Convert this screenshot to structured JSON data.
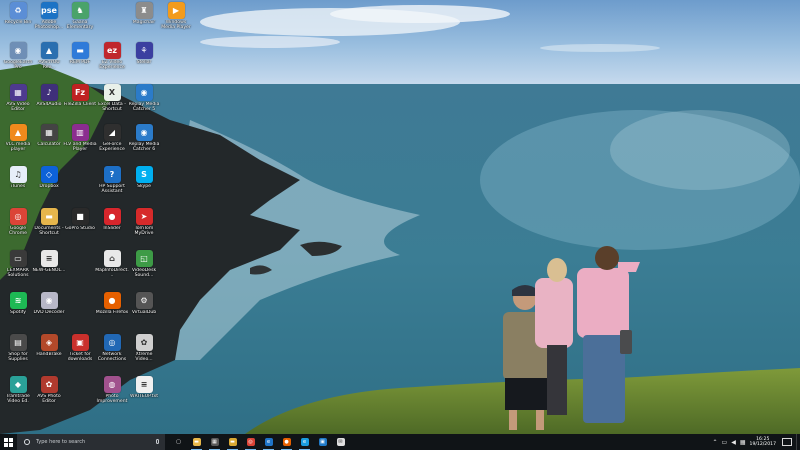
{
  "desktop": {
    "icons": [
      {
        "label": "Recycle Bin",
        "icon": "recycle-bin-icon",
        "color": "#5b8ed6",
        "glyph": "♻"
      },
      {
        "label": "GoogleEarth Pro",
        "icon": "google-earth-icon",
        "color": "#6f8fb6",
        "glyph": "◉"
      },
      {
        "label": "AVS Video Editor",
        "icon": "avs-video-editor-icon",
        "color": "#4e3a8f",
        "glyph": "▦"
      },
      {
        "label": "VLC media player",
        "icon": "vlc-icon",
        "color": "#f08a1c",
        "glyph": "▲"
      },
      {
        "label": "iTunes",
        "icon": "itunes-icon",
        "color": "#e7eef9",
        "glyph": "♫"
      },
      {
        "label": "Google Chrome",
        "icon": "chrome-icon",
        "color": "#db4437",
        "glyph": "◎"
      },
      {
        "label": "LEXMARK Solutions",
        "icon": "lexmark-icon",
        "color": "#3a3a3a",
        "glyph": "▭"
      },
      {
        "label": "Spotify",
        "icon": "spotify-icon",
        "color": "#1db954",
        "glyph": "≋"
      },
      {
        "label": "Shop for Supplies",
        "icon": "shop-supplies-icon",
        "color": "#4a4a4a",
        "glyph": "▤"
      },
      {
        "label": "Tramtrade Video Ed.",
        "icon": "tramtrade-video-icon",
        "color": "#2aa198",
        "glyph": "◆"
      },
      {
        "label": "Adobe Photoshop...",
        "icon": "photoshop-elements-icon",
        "color": "#1c73c5",
        "glyph": "pse"
      },
      {
        "label": "AVS4YOU Rev...",
        "icon": "avs4you-icon",
        "color": "#2a6fb0",
        "glyph": "▲"
      },
      {
        "label": "AVS4Audio",
        "icon": "avs-audio-icon",
        "color": "#3f2f7a",
        "glyph": "♪"
      },
      {
        "label": "Calculator",
        "icon": "calculator-icon",
        "color": "#444444",
        "glyph": "▦"
      },
      {
        "label": "Dropbox",
        "icon": "dropbox-icon",
        "color": "#0d62d8",
        "glyph": "◇"
      },
      {
        "label": "Documents - Shortcut",
        "icon": "documents-folder-icon",
        "color": "#e6b64c",
        "glyph": "▬"
      },
      {
        "label": "NEW-GENOL...",
        "icon": "new-document-icon",
        "color": "#e8e8e8",
        "glyph": "≡"
      },
      {
        "label": "DVD Decoder",
        "icon": "dvd-decoder-icon",
        "color": "#b7b7c7",
        "glyph": "◉"
      },
      {
        "label": "HandBrake",
        "icon": "handbrake-icon",
        "color": "#b2492a",
        "glyph": "◈"
      },
      {
        "label": "AVS Photo Editor",
        "icon": "avs-photo-editor-icon",
        "color": "#b03a2e",
        "glyph": "✿"
      },
      {
        "label": "Gaana Elementary",
        "icon": "gaana-elementary-icon",
        "color": "#4aa36a",
        "glyph": "♞"
      },
      {
        "label": "REM PDF",
        "icon": "rem-pdf-icon",
        "color": "#2f7bd9",
        "glyph": "▬"
      },
      {
        "label": "FileZilla Client",
        "icon": "filezilla-icon",
        "color": "#bf2222",
        "glyph": "Fz"
      },
      {
        "label": "FLV and Media Player",
        "icon": "flv-player-icon",
        "color": "#8b2d8f",
        "glyph": "▥"
      },
      {
        "label": "",
        "icon": "blank-slot-icon",
        "color": "#000000",
        "glyph": ""
      },
      {
        "label": "GoPro Studio",
        "icon": "gopro-studio-icon",
        "color": "#2a2a2a",
        "glyph": "■"
      },
      {
        "label": "",
        "icon": "blank-slot-icon",
        "color": "#000000",
        "glyph": ""
      },
      {
        "label": "",
        "icon": "blank-slot-icon",
        "color": "#000000",
        "glyph": ""
      },
      {
        "label": "Ticket for downloads",
        "icon": "ticket-icon",
        "color": "#c9302c",
        "glyph": "▣"
      },
      {
        "label": "",
        "icon": "blank-slot-icon",
        "color": "#000000",
        "glyph": ""
      },
      {
        "label": "",
        "icon": "blank-slot-icon",
        "color": "#000000",
        "glyph": ""
      },
      {
        "label": "EZ Video Experience",
        "icon": "ez-video-icon",
        "color": "#c0272d",
        "glyph": "ez"
      },
      {
        "label": "Excel Data - Shortcut",
        "icon": "excel-shortcut-icon",
        "color": "#e9f0e9",
        "glyph": "X"
      },
      {
        "label": "GeForce Experience",
        "icon": "geforce-icon",
        "color": "#2f2f2f",
        "glyph": "◢"
      },
      {
        "label": "HP Support Assistant",
        "icon": "hp-support-icon",
        "color": "#1d6fc6",
        "glyph": "?"
      },
      {
        "label": "InSlider",
        "icon": "inslider-icon",
        "color": "#d7262c",
        "glyph": "●"
      },
      {
        "label": "MapInfoDirect...",
        "icon": "mapinfo-icon",
        "color": "#e8e8e8",
        "glyph": "⌂"
      },
      {
        "label": "Mozilla Firefox",
        "icon": "firefox-icon",
        "color": "#e66000",
        "glyph": "●"
      },
      {
        "label": "Network Connections",
        "icon": "network-icon",
        "color": "#2168b5",
        "glyph": "◎"
      },
      {
        "label": "Photo Improvement",
        "icon": "photo-improvement-icon",
        "color": "#a0518d",
        "glyph": "◍"
      },
      {
        "label": "Magichair",
        "icon": "magichair-icon",
        "color": "#8c8c8c",
        "glyph": "♜"
      },
      {
        "label": "Stellar",
        "icon": "stellar-icon",
        "color": "#3b3fa0",
        "glyph": "⚘"
      },
      {
        "label": "Replay Media Catcher 5",
        "icon": "replay-media-catcher-5-icon",
        "color": "#2b7bc9",
        "glyph": "◉"
      },
      {
        "label": "Replay Media Catcher 6",
        "icon": "replay-media-catcher-6-icon",
        "color": "#2b7bc9",
        "glyph": "◉"
      },
      {
        "label": "Skype",
        "icon": "skype-icon",
        "color": "#00aff0",
        "glyph": "S"
      },
      {
        "label": "TomTom MyDrive",
        "icon": "tomtom-icon",
        "color": "#d62a2a",
        "glyph": "➤"
      },
      {
        "label": "VideoDesk Sound...",
        "icon": "videodesk-sound-icon",
        "color": "#3d9b46",
        "glyph": "◱"
      },
      {
        "label": "VirtualDub",
        "icon": "virtualdub-icon",
        "color": "#555555",
        "glyph": "⚙"
      },
      {
        "label": "Xtreme Video...",
        "icon": "xtreme-video-icon",
        "color": "#cfcfcf",
        "glyph": "✿"
      },
      {
        "label": "WRITEUP.txt",
        "icon": "text-file-icon",
        "color": "#f0f0f0",
        "glyph": "≡"
      },
      {
        "label": "Windows Media Player",
        "icon": "windows-media-player-icon",
        "color": "#f29b1c",
        "glyph": "▶"
      }
    ]
  },
  "taskbar": {
    "search_placeholder": "Type here to search",
    "apps": [
      {
        "icon": "task-view-icon",
        "color": "#101417",
        "glyph": "▢"
      },
      {
        "icon": "file-explorer-icon",
        "color": "#e8b84a",
        "glyph": "▬"
      },
      {
        "icon": "calculator-taskbar-icon",
        "color": "#5a5a5a",
        "glyph": "▦"
      },
      {
        "icon": "folder-taskbar-icon",
        "color": "#d9a933",
        "glyph": "▬"
      },
      {
        "icon": "chrome-taskbar-icon",
        "color": "#db4437",
        "glyph": "◎"
      },
      {
        "icon": "edge-taskbar-icon",
        "color": "#1f74c8",
        "glyph": "e"
      },
      {
        "icon": "firefox-taskbar-icon",
        "color": "#e66000",
        "glyph": "●"
      },
      {
        "icon": "ie-taskbar-icon",
        "color": "#1a9de0",
        "glyph": "e"
      },
      {
        "icon": "store-taskbar-icon",
        "color": "#1f7ac8",
        "glyph": "▣"
      },
      {
        "icon": "mail-taskbar-icon",
        "color": "#e0e0e0",
        "glyph": "✉"
      }
    ],
    "clock": {
      "time": "16:25",
      "date": "19/12/2017"
    }
  }
}
